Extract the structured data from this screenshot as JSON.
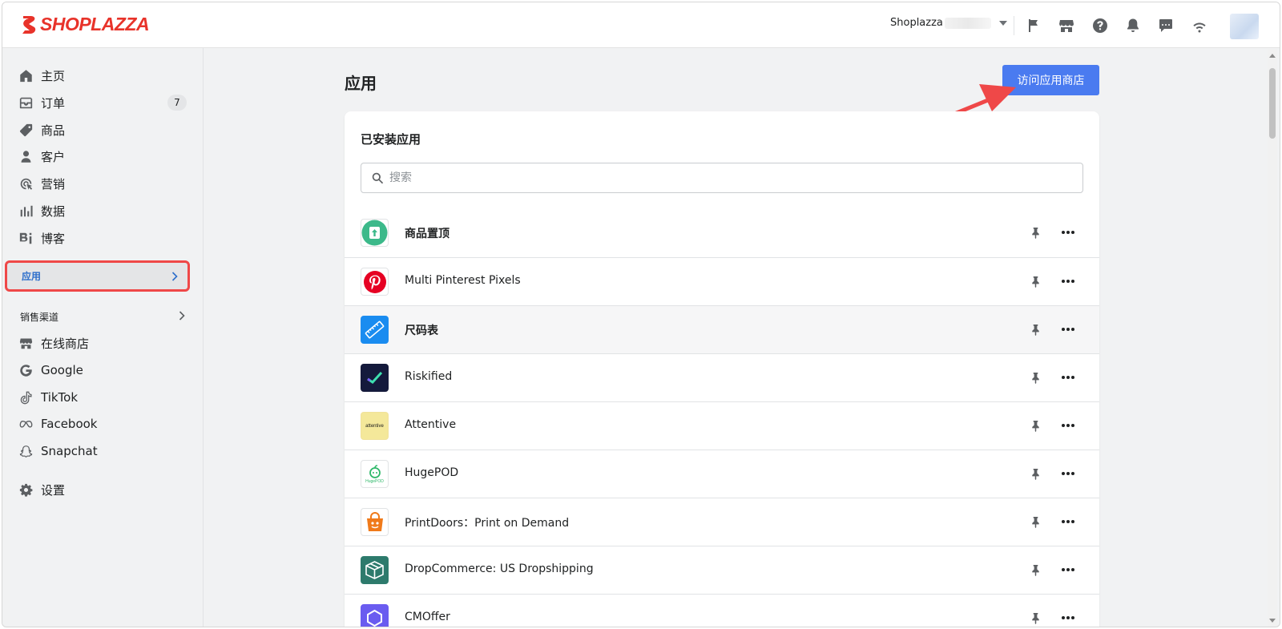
{
  "brand": {
    "logo_text": "SHOPLAZZA",
    "logo_color": "#e8332a"
  },
  "topbar": {
    "store_name": "Shoplazza",
    "icons": [
      "flag-icon",
      "store-icon",
      "help-icon",
      "bell-icon",
      "chat-icon",
      "wifi-icon"
    ]
  },
  "sidebar": {
    "items": [
      {
        "label": "主页",
        "icon": "home-icon"
      },
      {
        "label": "订单",
        "icon": "inbox-icon",
        "badge": "7"
      },
      {
        "label": "商品",
        "icon": "tag-icon"
      },
      {
        "label": "客户",
        "icon": "person-icon"
      },
      {
        "label": "营销",
        "icon": "marketing-icon"
      },
      {
        "label": "数据",
        "icon": "bars-icon"
      },
      {
        "label": "博客",
        "icon": "blog-icon"
      }
    ],
    "active_item": "应用",
    "sales_channels_label": "销售渠道",
    "channels": [
      {
        "label": "在线商店",
        "icon": "store-icon"
      },
      {
        "label": "Google",
        "icon": "google-icon"
      },
      {
        "label": "TikTok",
        "icon": "tiktok-icon"
      },
      {
        "label": "Facebook",
        "icon": "meta-icon"
      },
      {
        "label": "Snapchat",
        "icon": "snapchat-icon"
      }
    ],
    "settings_label": "设置"
  },
  "main": {
    "title": "应用",
    "visit_store_button": "访问应用商店",
    "accent_color": "#4a7bf0",
    "card_title": "已安装应用",
    "search_placeholder": "搜索",
    "apps": [
      {
        "name": "商品置顶"
      },
      {
        "name": "Multi Pinterest Pixels"
      },
      {
        "name": "尺码表"
      },
      {
        "name": "Riskified"
      },
      {
        "name": "Attentive",
        "icon_text": "attentive"
      },
      {
        "name": "HugePOD",
        "icon_text": "HugePOD"
      },
      {
        "name": "PrintDoors：Print on Demand"
      },
      {
        "name": "DropCommerce: US Dropshipping"
      },
      {
        "name": "CMOffer"
      }
    ]
  }
}
